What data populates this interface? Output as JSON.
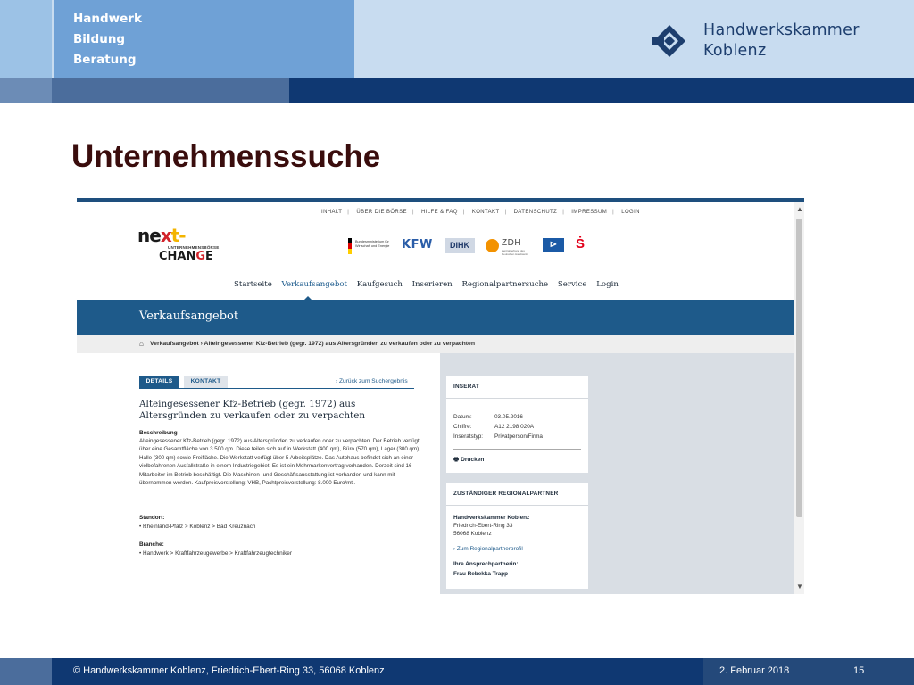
{
  "slide": {
    "nav_items": [
      "Handwerk",
      "Bildung",
      "Beratung"
    ],
    "logo_line1": "Handwerkskammer",
    "logo_line2": "Koblenz",
    "title": "Unternehmenssuche",
    "footer_copyright": "© Handwerkskammer Koblenz, Friedrich-Ebert-Ring 33, 56068 Koblenz",
    "footer_date": "2. Februar 2018",
    "page_number": "15"
  },
  "site": {
    "utility_nav": [
      "INHALT",
      "ÜBER DIE BÖRSE",
      "HILFE & FAQ",
      "KONTAKT",
      "DATENSCHUTZ",
      "IMPRESSUM",
      "LOGIN"
    ],
    "brand": {
      "part1": "ne",
      "part2": "x",
      "part3": "t-",
      "subline": "UNTERNEHMENSBÖRSE",
      "part4": "CHAN",
      "part5": "G",
      "part6": "E"
    },
    "partners": {
      "bmwi": "Bundesministerium für Wirtschaft und Energie",
      "kfw": "KFW",
      "dihk": "DIHK",
      "zdh": "ZDH",
      "zdh_sub": "Zentralverband des Deutschen Handwerks",
      "vb": "⊳",
      "spk": "Ṡ"
    },
    "main_nav": [
      "Startseite",
      "Verkaufsangebot",
      "Kaufgesuch",
      "Inserieren",
      "Regionalpartnersuche",
      "Service",
      "Login"
    ],
    "page_header": "Verkaufsangebot",
    "breadcrumb": "Verkaufsangebot  ›  Alteingesessener Kfz-Betrieb (gegr. 1972) aus Altersgründen zu verkaufen oder zu verpachten",
    "tabs": {
      "details": "DETAILS",
      "kontakt": "KONTAKT"
    },
    "back_link": "› Zurück zum Suchergebnis",
    "ad": {
      "title": "Alteingesessener Kfz-Betrieb (gegr. 1972) aus Altersgründen zu verkaufen oder zu verpachten",
      "desc_heading": "Beschreibung",
      "description": "Alteingesessener Kfz-Betrieb (gegr. 1972) aus Altersgründen zu verkaufen oder zu verpachten. Der Betrieb verfügt über eine Gesamtfläche von 3.500 qm. Diese teilen sich auf in Werkstatt (400 qm), Büro (570 qm), Lager (300 qm), Halle (300 qm) sowie Freifläche. Die Werkstatt verfügt über 5 Arbeitsplätze. Das Autohaus befindet sich an einer vielbefahrenen Ausfallstraße in einem Industriegebiet. Es ist ein Mehrmarkenvertrag vorhanden. Derzeit sind 16 Mitarbeiter im Betrieb beschäftigt. Die Maschinen- und Geschäftsausstattung ist vorhanden und kann mit übernommen werden. Kaufpreisvorstellung: VHB, Pachtpreisvorstellung: 8.000 Euro/mtl.",
      "location_heading": "Standort:",
      "location": "• Rheinland-Pfalz > Koblenz > Bad Kreuznach",
      "branch_heading": "Branche:",
      "branch": "• Handwerk > Kraftfahrzeugewerbe > Kraftfahrzeugtechniker"
    },
    "inserat": {
      "heading": "INSERAT",
      "date_label": "Datum:",
      "date_value": "03.05.2016",
      "chiffre_label": "Chiffre:",
      "chiffre_value": "A12 2198 020A",
      "type_label": "Inseratstyp:",
      "type_value": "Privatperson/Firma",
      "print": "Drucken"
    },
    "regional": {
      "heading": "ZUSTÄNDIGER REGIONALPARTNER",
      "name": "Handwerkskammer Koblenz",
      "street": "Friedrich-Ebert-Ring 33",
      "city": "56068 Koblenz",
      "profile_link": "› Zum Regionalpartnerprofil",
      "contact_heading": "Ihre Ansprechpartnerin:",
      "contact_name": "Frau Rebekka Trapp"
    }
  }
}
